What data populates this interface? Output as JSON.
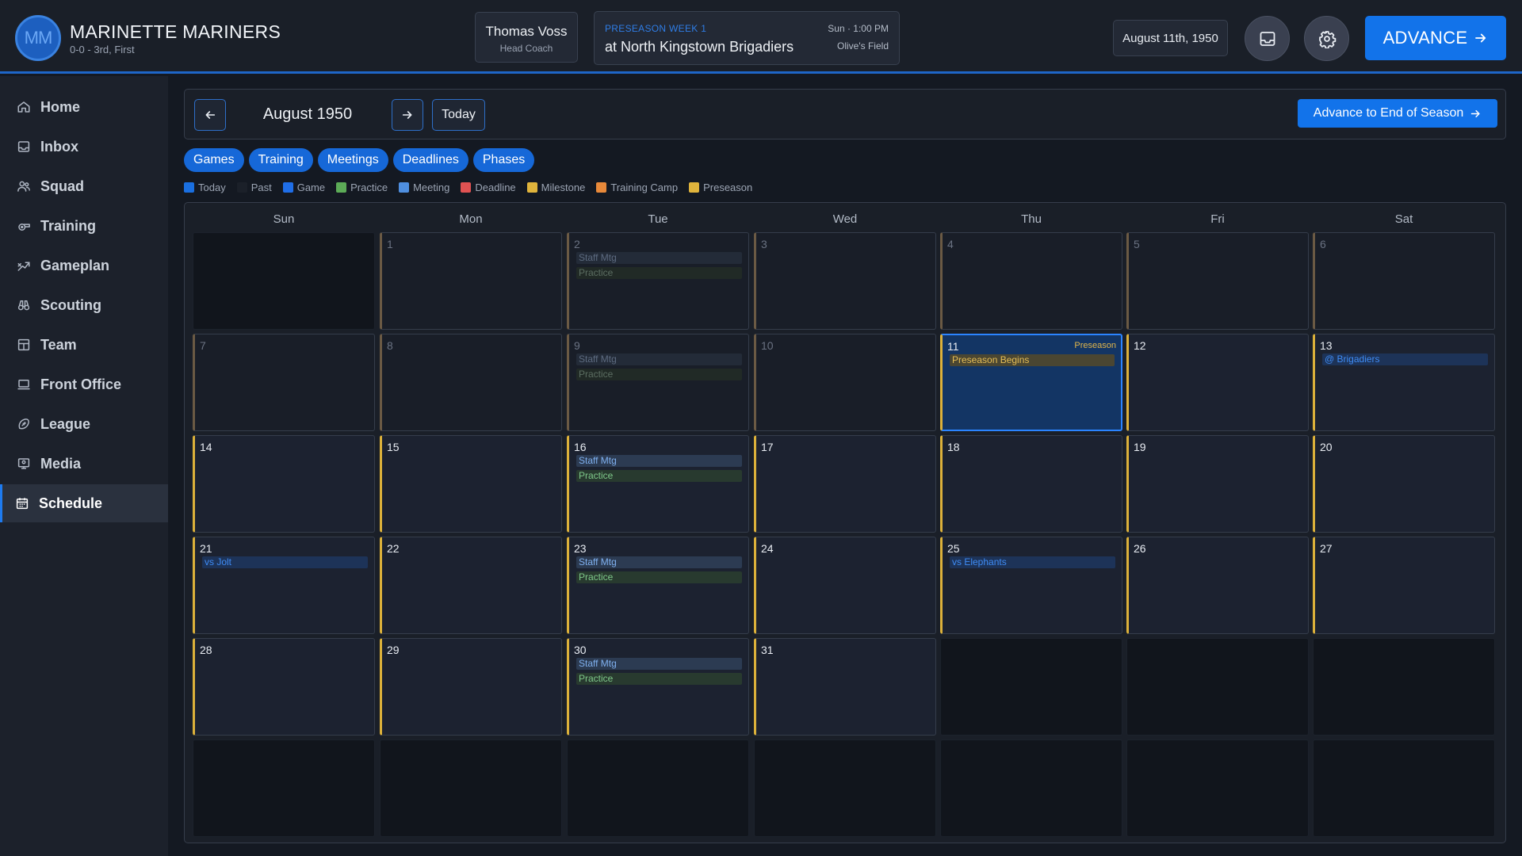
{
  "header": {
    "team_initials": "MM",
    "team_name": "MARINETTE MARINERS",
    "team_record": "0-0 - 3rd, First",
    "coach_name": "Thomas Voss",
    "coach_role": "Head Coach",
    "next_game": {
      "week": "PRESEASON WEEK 1",
      "opponent": "at North Kingstown Brigadiers",
      "time": "Sun · 1:00 PM",
      "venue": "Olive's Field"
    },
    "current_date": "August 11th, 1950",
    "advance_label": "ADVANCE"
  },
  "sidebar": {
    "items": [
      {
        "label": "Home",
        "icon": "home-icon"
      },
      {
        "label": "Inbox",
        "icon": "inbox-icon"
      },
      {
        "label": "Squad",
        "icon": "users-icon"
      },
      {
        "label": "Training",
        "icon": "whistle-icon"
      },
      {
        "label": "Gameplan",
        "icon": "strategy-icon"
      },
      {
        "label": "Scouting",
        "icon": "binoculars-icon"
      },
      {
        "label": "Team",
        "icon": "layout-icon"
      },
      {
        "label": "Front Office",
        "icon": "laptop-icon"
      },
      {
        "label": "League",
        "icon": "football-icon"
      },
      {
        "label": "Media",
        "icon": "media-icon"
      },
      {
        "label": "Schedule",
        "icon": "calendar-icon"
      }
    ],
    "active": "Schedule"
  },
  "calendar_header": {
    "month_label": "August 1950",
    "today_label": "Today",
    "end_of_season_label": "Advance to End of Season"
  },
  "filters": [
    "Games",
    "Training",
    "Meetings",
    "Deadlines",
    "Phases"
  ],
  "legend": [
    {
      "label": "Today",
      "color": "#1a6fe0"
    },
    {
      "label": "Past",
      "color": "#1b2029"
    },
    {
      "label": "Game",
      "color": "#1f6ee8"
    },
    {
      "label": "Practice",
      "color": "#5cab57"
    },
    {
      "label": "Meeting",
      "color": "#4f8fe0"
    },
    {
      "label": "Deadline",
      "color": "#e05252"
    },
    {
      "label": "Milestone",
      "color": "#e0b43c"
    },
    {
      "label": "Training Camp",
      "color": "#e8893a"
    },
    {
      "label": "Preseason",
      "color": "#e0b43c"
    }
  ],
  "weekdays": [
    "Sun",
    "Mon",
    "Tue",
    "Wed",
    "Thu",
    "Fri",
    "Sat"
  ],
  "weeks": [
    [
      {
        "blank": true
      },
      {
        "day": "1",
        "state": "past",
        "events": []
      },
      {
        "day": "2",
        "state": "past",
        "events": [
          {
            "label": "Staff Mtg",
            "kind": "meeting"
          },
          {
            "label": "Practice",
            "kind": "practice"
          }
        ]
      },
      {
        "day": "3",
        "state": "past",
        "events": []
      },
      {
        "day": "4",
        "state": "past",
        "events": []
      },
      {
        "day": "5",
        "state": "past",
        "events": []
      },
      {
        "day": "6",
        "state": "past",
        "events": []
      }
    ],
    [
      {
        "day": "7",
        "state": "past",
        "events": []
      },
      {
        "day": "8",
        "state": "past",
        "events": []
      },
      {
        "day": "9",
        "state": "past",
        "events": [
          {
            "label": "Staff Mtg",
            "kind": "meeting"
          },
          {
            "label": "Practice",
            "kind": "practice"
          }
        ]
      },
      {
        "day": "10",
        "state": "past",
        "events": []
      },
      {
        "day": "11",
        "state": "today",
        "tag": "Preseason",
        "events": [
          {
            "label": "Preseason Begins",
            "kind": "milestone"
          }
        ]
      },
      {
        "day": "12",
        "state": "future",
        "events": []
      },
      {
        "day": "13",
        "state": "future",
        "events": [
          {
            "label": "@ Brigadiers",
            "kind": "game"
          }
        ]
      }
    ],
    [
      {
        "day": "14",
        "state": "future",
        "events": []
      },
      {
        "day": "15",
        "state": "future",
        "events": []
      },
      {
        "day": "16",
        "state": "future",
        "events": [
          {
            "label": "Staff Mtg",
            "kind": "meeting"
          },
          {
            "label": "Practice",
            "kind": "practice"
          }
        ]
      },
      {
        "day": "17",
        "state": "future",
        "events": []
      },
      {
        "day": "18",
        "state": "future",
        "events": []
      },
      {
        "day": "19",
        "state": "future",
        "events": []
      },
      {
        "day": "20",
        "state": "future",
        "events": []
      }
    ],
    [
      {
        "day": "21",
        "state": "future",
        "events": [
          {
            "label": "vs Jolt",
            "kind": "game"
          }
        ]
      },
      {
        "day": "22",
        "state": "future",
        "events": []
      },
      {
        "day": "23",
        "state": "future",
        "events": [
          {
            "label": "Staff Mtg",
            "kind": "meeting"
          },
          {
            "label": "Practice",
            "kind": "practice"
          }
        ]
      },
      {
        "day": "24",
        "state": "future",
        "events": []
      },
      {
        "day": "25",
        "state": "future",
        "events": [
          {
            "label": "vs Elephants",
            "kind": "game"
          }
        ]
      },
      {
        "day": "26",
        "state": "future",
        "events": []
      },
      {
        "day": "27",
        "state": "future",
        "events": []
      }
    ],
    [
      {
        "day": "28",
        "state": "future",
        "events": []
      },
      {
        "day": "29",
        "state": "future",
        "events": []
      },
      {
        "day": "30",
        "state": "future",
        "events": [
          {
            "label": "Staff Mtg",
            "kind": "meeting"
          },
          {
            "label": "Practice",
            "kind": "practice"
          }
        ]
      },
      {
        "day": "31",
        "state": "future",
        "events": []
      },
      {
        "blank": true
      },
      {
        "blank": true
      },
      {
        "blank": true
      }
    ],
    [
      {
        "blank": true
      },
      {
        "blank": true
      },
      {
        "blank": true
      },
      {
        "blank": true
      },
      {
        "blank": true
      },
      {
        "blank": true
      },
      {
        "blank": true
      }
    ]
  ]
}
